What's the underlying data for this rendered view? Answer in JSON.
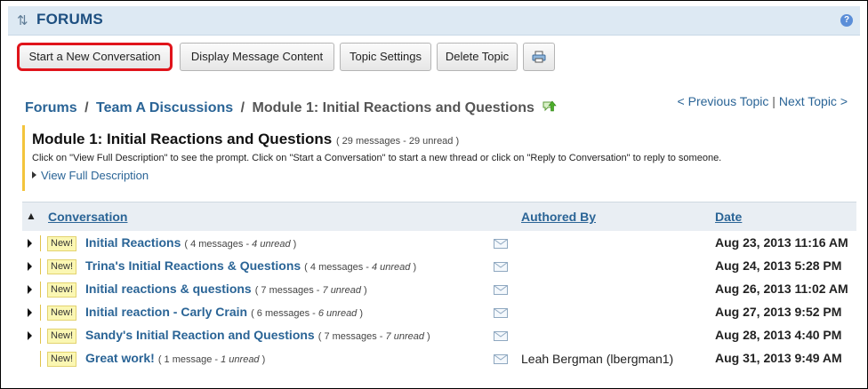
{
  "header": {
    "title": "FORUMS",
    "help_icon": "help-icon"
  },
  "toolbar": {
    "start_label": "Start a New Conversation",
    "display_label": "Display Message Content",
    "settings_label": "Topic Settings",
    "delete_label": "Delete Topic",
    "print_icon": "printer-icon"
  },
  "breadcrumb": {
    "forums": "Forums",
    "sep1": "/",
    "group": "Team A Discussions",
    "sep2": "/",
    "current": "Module 1: Initial Reactions and Questions",
    "watch_icon": "watch-topic-icon"
  },
  "nav": {
    "prev": "< Previous Topic",
    "sep": "|",
    "next": "Next Topic >"
  },
  "topic": {
    "title": "Module 1: Initial Reactions and Questions",
    "count": "( 29 messages - 29 unread )",
    "instructions": "Click on \"View Full Description\" to see the prompt. Click on \"Start a Conversation\" to start a new thread or click on \"Reply to Conversation\" to reply to someone.",
    "view_full": "View Full Description"
  },
  "table": {
    "headers": {
      "conversation": "Conversation",
      "authored_by": "Authored By",
      "date": "Date"
    },
    "new_label": "New!",
    "rows": [
      {
        "title": "Initial Reactions",
        "meta_pre": "( 4 messages - ",
        "unread": "4 unread",
        "meta_post": " )",
        "author": "",
        "date": "Aug 23, 2013 11:16 AM",
        "expandable": true
      },
      {
        "title": "Trina's Initial Reactions & Questions",
        "meta_pre": "( 4 messages - ",
        "unread": "4 unread",
        "meta_post": " )",
        "author": "",
        "date": "Aug 24, 2013 5:28 PM",
        "expandable": true
      },
      {
        "title": "Initial reactions & questions",
        "meta_pre": "( 7 messages - ",
        "unread": "7 unread",
        "meta_post": " )",
        "author": "",
        "date": "Aug 26, 2013 11:02 AM",
        "expandable": true
      },
      {
        "title": "Initial reaction - Carly Crain",
        "meta_pre": "( 6 messages - ",
        "unread": "6 unread",
        "meta_post": " )",
        "author": "",
        "date": "Aug 27, 2013 9:52 PM",
        "expandable": true
      },
      {
        "title": "Sandy's Initial Reaction and Questions",
        "meta_pre": "( 7 messages - ",
        "unread": "7 unread",
        "meta_post": " )",
        "author": "",
        "date": "Aug 28, 2013 4:40 PM",
        "expandable": true
      },
      {
        "title": "Great work!",
        "meta_pre": "( 1 message - ",
        "unread": "1 unread",
        "meta_post": " )",
        "author": "Leah Bergman (lbergman1)",
        "date": "Aug 31, 2013 9:49 AM",
        "expandable": false
      }
    ]
  },
  "colors": {
    "link": "#2a6496",
    "header_bg": "#dde9f3",
    "highlight": "#e0141b",
    "new_badge": "#fbf7b3"
  }
}
